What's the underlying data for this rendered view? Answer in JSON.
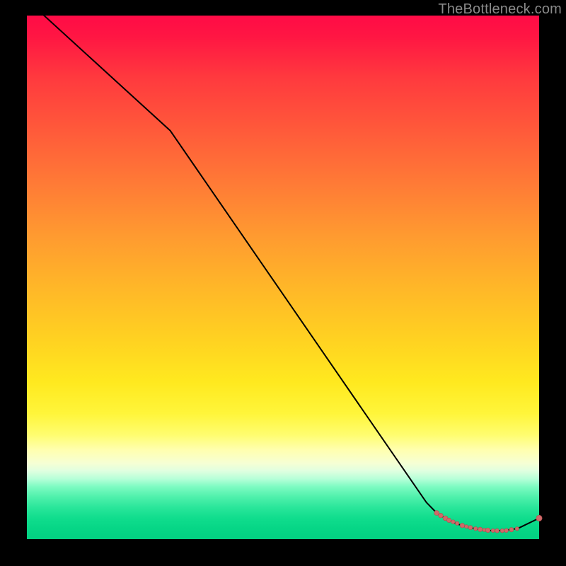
{
  "watermark": "TheBottleneck.com",
  "colors": {
    "curve": "#000000",
    "marker_fill": "#cf6a6a",
    "marker_stroke": "#b44d4d"
  },
  "chart_data": {
    "type": "line",
    "title": "",
    "xlabel": "",
    "ylabel": "",
    "xlim": [
      0,
      100
    ],
    "ylim": [
      0,
      100
    ],
    "series": [
      {
        "name": "bottleneck-curve",
        "x": [
          0,
          28,
          78,
          80,
          81,
          82,
          83,
          84,
          85,
          86,
          87,
          88,
          89,
          90,
          91,
          92,
          93,
          94,
          95,
          96,
          100
        ],
        "y": [
          103,
          78,
          7.0,
          5.0,
          4.4,
          3.8,
          3.3,
          2.9,
          2.6,
          2.3,
          2.1,
          1.9,
          1.75,
          1.65,
          1.6,
          1.6,
          1.65,
          1.75,
          1.9,
          2.1,
          4.0
        ]
      }
    ],
    "markers": [
      {
        "x": 80.0,
        "y": 5.0,
        "r": 3.5
      },
      {
        "x": 80.8,
        "y": 4.5,
        "r": 3.3
      },
      {
        "x": 81.7,
        "y": 4.0,
        "r": 3.4
      },
      {
        "x": 82.4,
        "y": 3.6,
        "r": 3.2
      },
      {
        "x": 83.2,
        "y": 3.3,
        "r": 2.8
      },
      {
        "x": 84.0,
        "y": 3.0,
        "r": 2.7
      },
      {
        "x": 85.0,
        "y": 2.6,
        "r": 3.3
      },
      {
        "x": 85.8,
        "y": 2.4,
        "r": 2.6
      },
      {
        "x": 86.6,
        "y": 2.2,
        "r": 3.0
      },
      {
        "x": 87.6,
        "y": 2.0,
        "r": 2.8
      },
      {
        "x": 88.5,
        "y": 1.85,
        "r": 3.2
      },
      {
        "x": 89.3,
        "y": 1.75,
        "r": 2.5
      },
      {
        "x": 90.0,
        "y": 1.7,
        "r": 3.3
      },
      {
        "x": 91.0,
        "y": 1.63,
        "r": 2.7
      },
      {
        "x": 91.8,
        "y": 1.6,
        "r": 3.0
      },
      {
        "x": 92.8,
        "y": 1.6,
        "r": 2.8
      },
      {
        "x": 93.6,
        "y": 1.65,
        "r": 2.9
      },
      {
        "x": 94.6,
        "y": 1.8,
        "r": 3.1
      },
      {
        "x": 95.7,
        "y": 2.0,
        "r": 2.7
      },
      {
        "x": 100.0,
        "y": 4.0,
        "r": 4.2
      }
    ]
  }
}
